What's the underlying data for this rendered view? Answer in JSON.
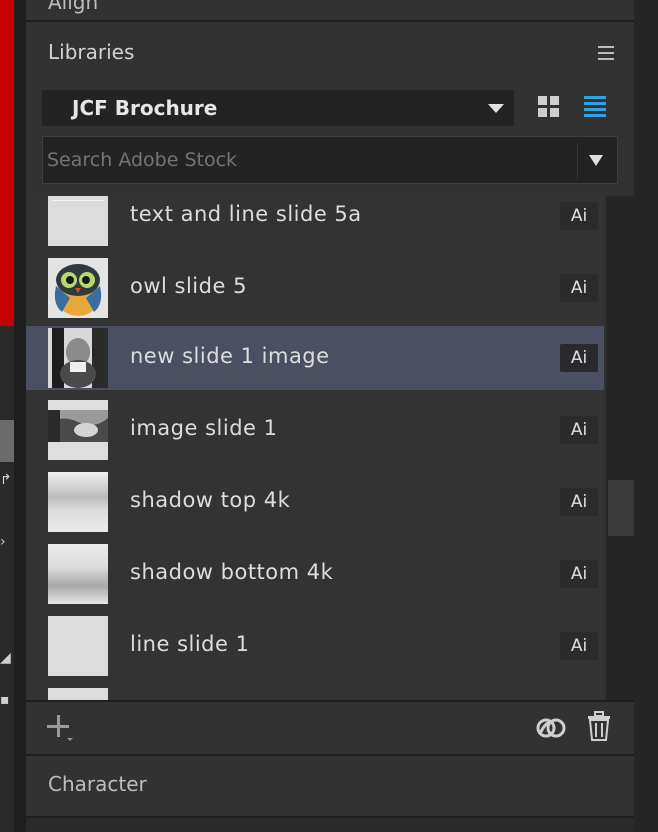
{
  "align_panel": {
    "title": "Align"
  },
  "libraries_panel": {
    "title": "Libraries",
    "menu_icon": "hamburger-menu-icon",
    "library_selector": {
      "value": "JCF Brochure"
    },
    "view_toggle": {
      "grid_icon": "grid-view-icon",
      "list_icon": "list-view-icon",
      "active": "list",
      "active_color": "#2ea3e0"
    },
    "search": {
      "placeholder": "Search Adobe Stock",
      "value": ""
    },
    "items": [
      {
        "name": "text and line slide 5a",
        "badge": "Ai",
        "thumbnail": "light-gray-swatch",
        "selected": false
      },
      {
        "name": "owl slide 5",
        "badge": "Ai",
        "thumbnail": "owl-illustration",
        "selected": false
      },
      {
        "name": "new slide 1 image",
        "badge": "Ai",
        "thumbnail": "bw-portrait-photo",
        "selected": true
      },
      {
        "name": "image slide 1",
        "badge": "Ai",
        "thumbnail": "bw-landscape-photo",
        "selected": false
      },
      {
        "name": "shadow top 4k",
        "badge": "Ai",
        "thumbnail": "gradient-top",
        "selected": false
      },
      {
        "name": "shadow bottom 4k",
        "badge": "Ai",
        "thumbnail": "gradient-bottom",
        "selected": false
      },
      {
        "name": "line slide 1",
        "badge": "Ai",
        "thumbnail": "light-gray-swatch",
        "selected": false
      }
    ],
    "footer": {
      "add_icon": "plus-icon",
      "cc_icon": "creative-cloud-icon",
      "delete_icon": "trash-icon"
    }
  },
  "character_panel": {
    "title": "Character"
  },
  "colors": {
    "panel_bg": "#323232",
    "selected_row": "#4a5061",
    "accent_blue": "#2ea3e0",
    "app_red": "#c40000"
  }
}
